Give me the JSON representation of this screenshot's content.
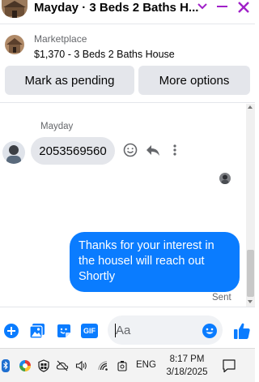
{
  "header": {
    "title": "Mayday · 3 Beds 2 Baths H...",
    "accent": "#a020c8"
  },
  "listing": {
    "label": "Marketplace",
    "text": "$1,370 - 3 Beds 2 Baths House"
  },
  "actions": {
    "pending_label": "Mark as pending",
    "more_label": "More options"
  },
  "conversation": {
    "sender_name": "Mayday",
    "incoming_message": "2053569560",
    "outgoing_message": "Thanks for your interest in the housel will reach out Shortly",
    "sent_status": "Sent"
  },
  "composer": {
    "placeholder": "Aa",
    "gif_label": "GIF",
    "brand_color": "#0a7cff"
  },
  "taskbar": {
    "language": "ENG",
    "time": "8:17 PM",
    "date": "3/18/2025"
  }
}
